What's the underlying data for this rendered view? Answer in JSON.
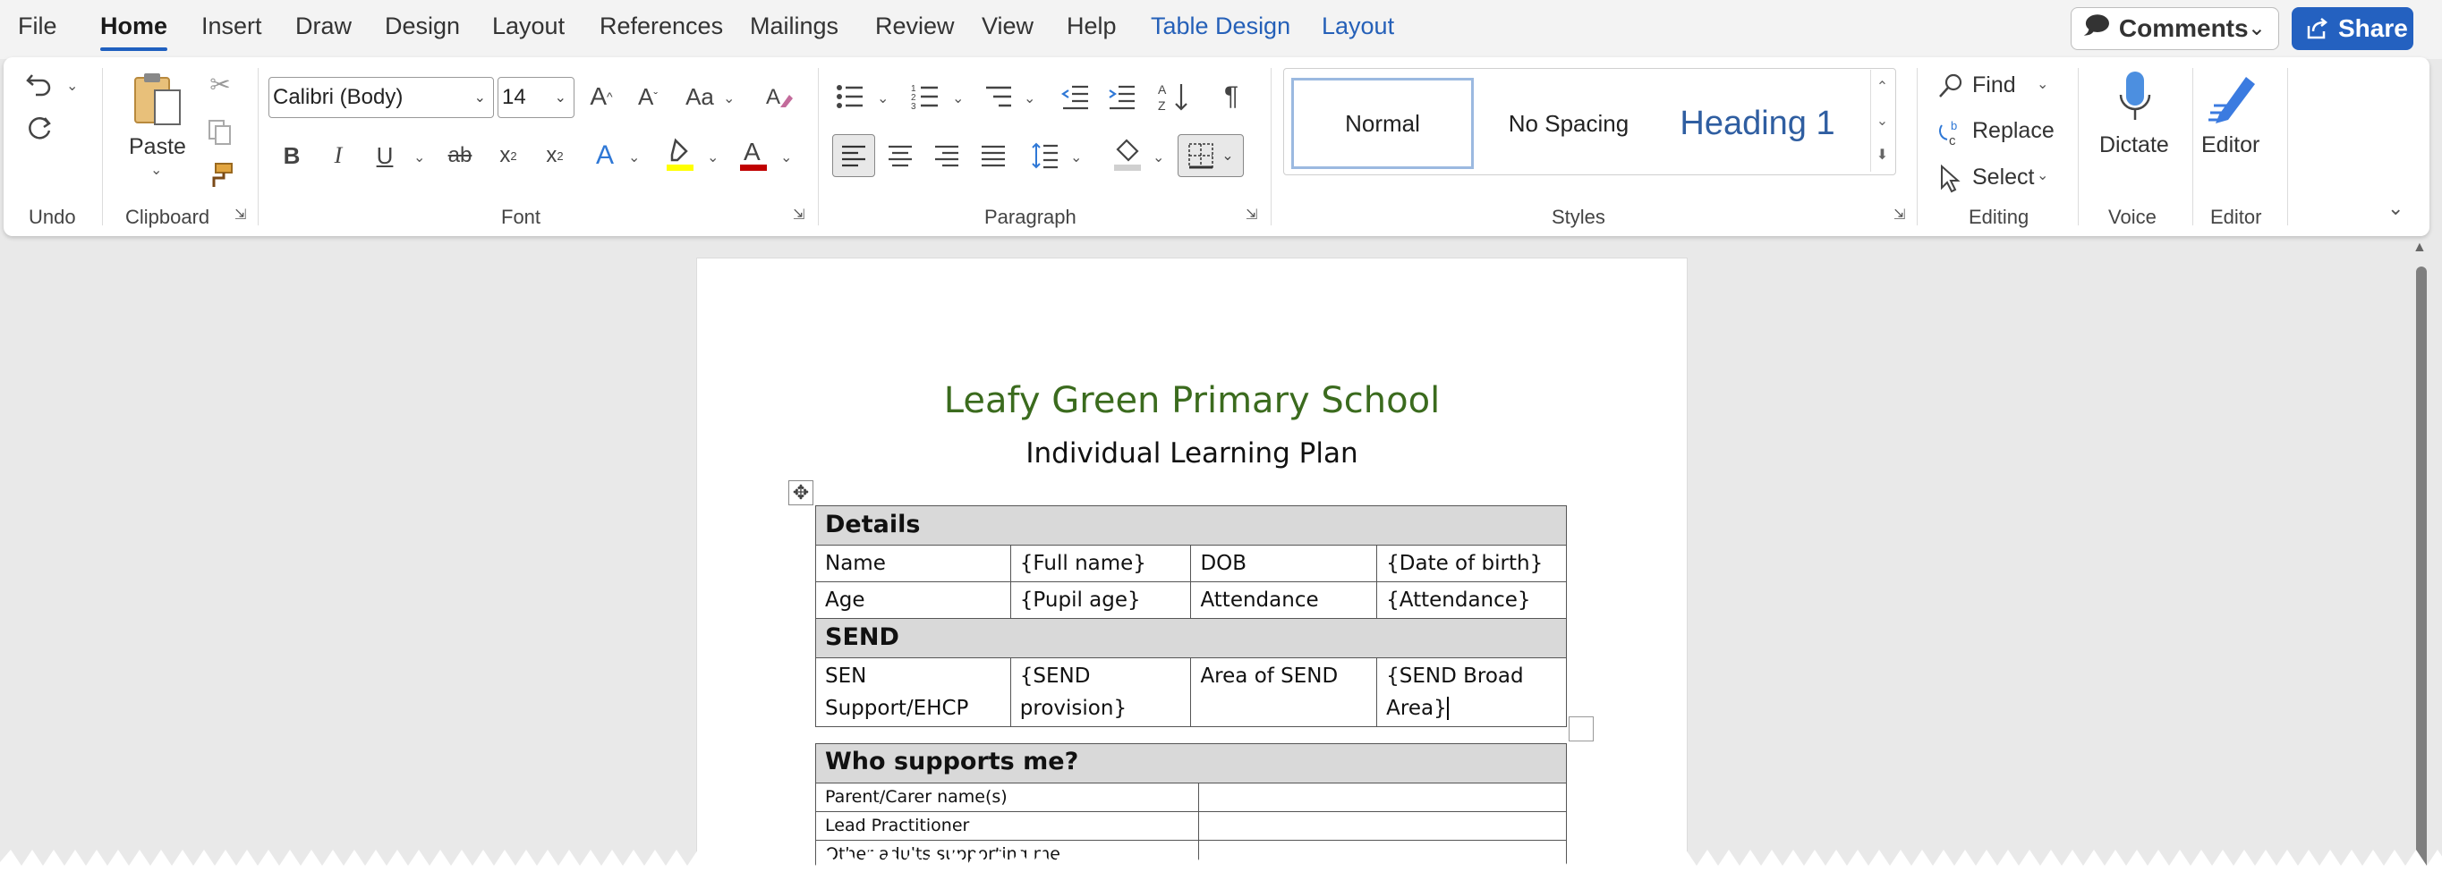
{
  "menu": {
    "tabs": [
      {
        "label": "File",
        "active": false,
        "contextual": false
      },
      {
        "label": "Home",
        "active": true,
        "contextual": false
      },
      {
        "label": "Insert",
        "active": false,
        "contextual": false
      },
      {
        "label": "Draw",
        "active": false,
        "contextual": false
      },
      {
        "label": "Design",
        "active": false,
        "contextual": false
      },
      {
        "label": "Layout",
        "active": false,
        "contextual": false
      },
      {
        "label": "References",
        "active": false,
        "contextual": false
      },
      {
        "label": "Mailings",
        "active": false,
        "contextual": false
      },
      {
        "label": "Review",
        "active": false,
        "contextual": false
      },
      {
        "label": "View",
        "active": false,
        "contextual": false
      },
      {
        "label": "Help",
        "active": false,
        "contextual": false
      },
      {
        "label": "Table Design",
        "active": false,
        "contextual": true
      },
      {
        "label": "Layout",
        "active": false,
        "contextual": true
      }
    ],
    "comments_label": "Comments",
    "share_label": "Share"
  },
  "ribbon": {
    "groups": {
      "undo": "Undo",
      "clipboard": "Clipboard",
      "font": "Font",
      "paragraph": "Paragraph",
      "styles": "Styles",
      "editing": "Editing",
      "voice": "Voice",
      "editor": "Editor"
    },
    "paste_label": "Paste",
    "font_name": "Calibri (Body)",
    "font_size": "14",
    "styles": [
      "Normal",
      "No Spacing",
      "Heading 1"
    ],
    "editing": {
      "find": "Find",
      "replace": "Replace",
      "select": "Select"
    },
    "dictate_label": "Dictate",
    "editor_label": "Editor",
    "colors": {
      "highlight": "#ffff00",
      "font_color": "#c00000",
      "accent": "#2461c0"
    }
  },
  "document": {
    "school_title": "Leafy Green Primary School",
    "plan_title": "Individual Learning Plan",
    "details_table": {
      "details_header": "Details",
      "row1": [
        "Name",
        "{Full name}",
        "DOB",
        "{Date of birth}"
      ],
      "row2": [
        "Age",
        "{Pupil age}",
        "Attendance",
        "{Attendance}"
      ],
      "send_header": "SEND",
      "row3": [
        "SEN Support/EHCP",
        "{SEND provision}",
        "Area of SEND",
        "{SEND Broad Area}"
      ]
    },
    "support_table": {
      "header": "Who supports me?",
      "rows": [
        [
          "Parent/Carer name(s)",
          ""
        ],
        [
          "Lead Practitioner",
          ""
        ],
        [
          "Other adults supporting me",
          ""
        ]
      ]
    }
  }
}
